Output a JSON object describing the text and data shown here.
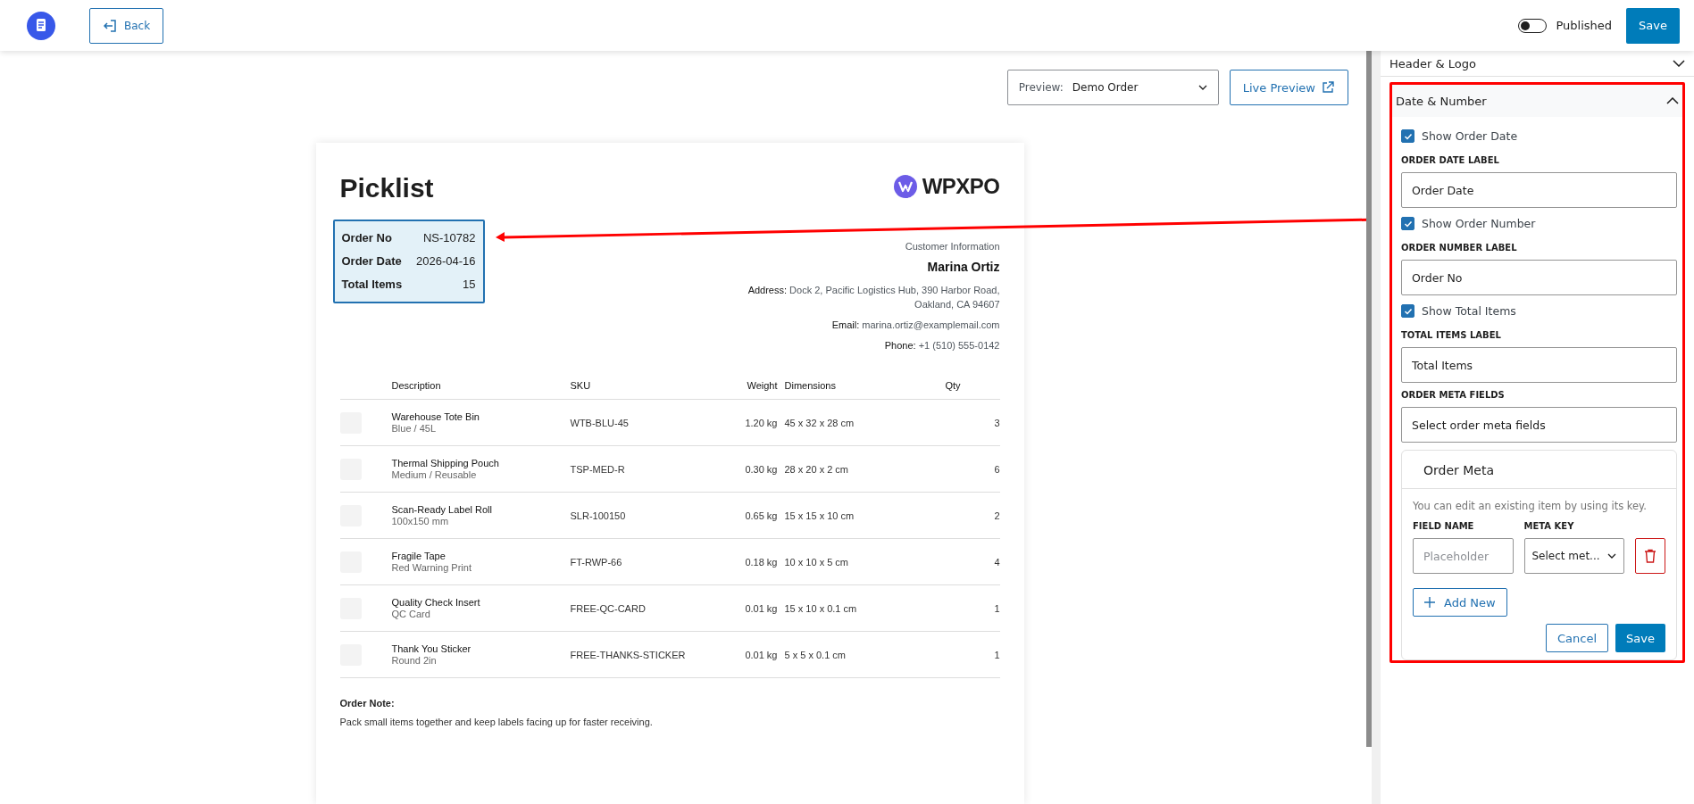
{
  "topbar": {
    "back": "Back",
    "published": {
      "label": "Published",
      "on": false
    },
    "save": "Save"
  },
  "preview": {
    "label": "Preview:",
    "value": "Demo Order",
    "live": "Live Preview"
  },
  "document": {
    "title": "Picklist",
    "logo_text": "WPXPO",
    "order_info": [
      {
        "label": "Order No",
        "value": "NS-10782"
      },
      {
        "label": "Order Date",
        "value": "2026-04-16"
      },
      {
        "label": "Total Items",
        "value": "15"
      }
    ],
    "customer": {
      "heading": "Customer Information",
      "name": "Marina Ortiz",
      "fields": [
        {
          "label": "Address:",
          "value": "Dock 2, Pacific Logistics Hub, 390 Harbor Road, Oakland, CA 94607"
        },
        {
          "label": "Email:",
          "value": "marina.ortiz@examplemail.com"
        },
        {
          "label": "Phone:",
          "value": "+1 (510) 555-0142"
        }
      ]
    },
    "table": {
      "columns": [
        "Description",
        "SKU",
        "Weight",
        "Dimensions",
        "Qty"
      ],
      "rows": [
        {
          "description": "Warehouse Tote Bin",
          "variant": "Blue / 45L",
          "sku": "WTB-BLU-45",
          "weight": "1.20 kg",
          "dimensions": "45 x 32 x 28 cm",
          "qty": "3"
        },
        {
          "description": "Thermal Shipping Pouch",
          "variant": "Medium / Reusable",
          "sku": "TSP-MED-R",
          "weight": "0.30 kg",
          "dimensions": "28 x 20 x 2 cm",
          "qty": "6"
        },
        {
          "description": "Scan-Ready Label Roll",
          "variant": "100x150 mm",
          "sku": "SLR-100150",
          "weight": "0.65 kg",
          "dimensions": "15 x 15 x 10 cm",
          "qty": "2"
        },
        {
          "description": "Fragile Tape",
          "variant": "Red Warning Print",
          "sku": "FT-RWP-66",
          "weight": "0.18 kg",
          "dimensions": "10 x 10 x 5 cm",
          "qty": "4"
        },
        {
          "description": "Quality Check Insert",
          "variant": "QC Card",
          "sku": "FREE-QC-CARD",
          "weight": "0.01 kg",
          "dimensions": "15 x 10 x 0.1 cm",
          "qty": "1"
        },
        {
          "description": "Thank You Sticker",
          "variant": "Round 2in",
          "sku": "FREE-THANKS-STICKER",
          "weight": "0.01 kg",
          "dimensions": "5 x 5 x 0.1 cm",
          "qty": "1"
        }
      ]
    },
    "note": {
      "heading": "Order Note:",
      "text": "Pack small items together and keep labels facing up for faster receiving."
    }
  },
  "sidebar": {
    "sections": [
      {
        "title": "Header & Logo",
        "expanded": false,
        "highlighted": false
      },
      {
        "title": "Date & Number",
        "expanded": true,
        "highlighted": true,
        "settings": [
          {
            "kind": "checkbox",
            "label": "Show Order Date",
            "checked": true
          },
          {
            "kind": "text",
            "label": "ORDER DATE LABEL",
            "value": "Order Date"
          },
          {
            "kind": "checkbox",
            "label": "Show Order Number",
            "checked": true
          },
          {
            "kind": "text",
            "label": "ORDER NUMBER LABEL",
            "value": "Order No"
          },
          {
            "kind": "checkbox",
            "label": "Show Total Items",
            "checked": true
          },
          {
            "kind": "text",
            "label": "TOTAL ITEMS LABEL",
            "value": "Total Items"
          },
          {
            "kind": "select",
            "label": "ORDER META FIELDS",
            "placeholder": "Select order meta fields"
          }
        ],
        "meta_panel": {
          "title": "Order Meta",
          "hint": "You can edit an existing item by using its key.",
          "field_name_label": "FIELD NAME",
          "meta_key_label": "META KEY",
          "field_placeholder": "Placeholder",
          "meta_key_value": "Select met...",
          "add": "Add New",
          "cancel": "Cancel",
          "save": "Save"
        }
      }
    ]
  }
}
